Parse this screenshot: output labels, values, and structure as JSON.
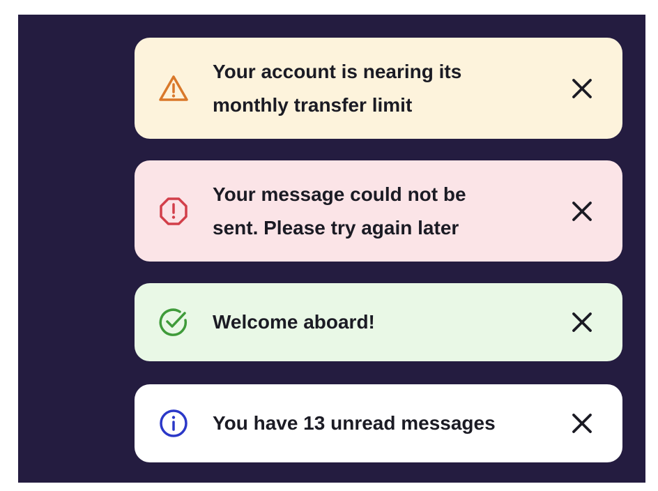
{
  "toasts": [
    {
      "type": "warning",
      "icon": "warning-triangle-icon",
      "message": "Your account is nearing its monthly transfer limit",
      "color": "#d9782a"
    },
    {
      "type": "error",
      "icon": "error-octagon-icon",
      "message": "Your message could not be sent. Please try again later",
      "color": "#d23f4a"
    },
    {
      "type": "success",
      "icon": "check-circle-icon",
      "message": "Welcome aboard!",
      "color": "#3f9b3a"
    },
    {
      "type": "info",
      "icon": "info-circle-icon",
      "message": "You have 13 unread messages",
      "color": "#2b38c8"
    }
  ],
  "close_icon": "close-icon",
  "background_color": "#241c40"
}
